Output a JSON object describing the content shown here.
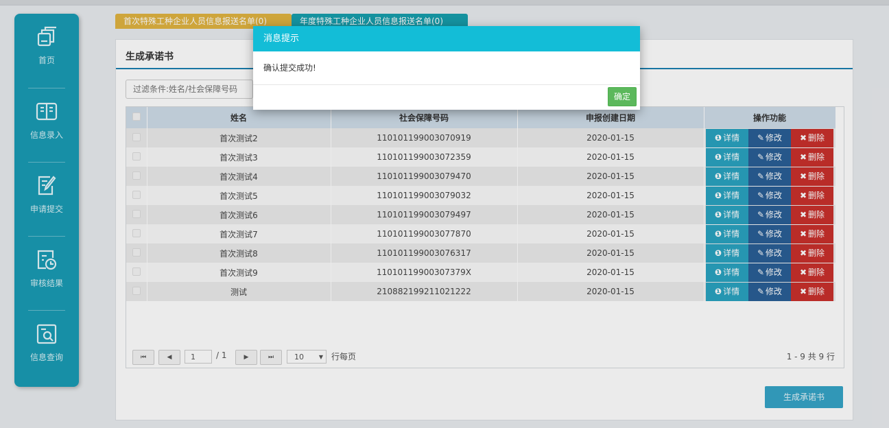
{
  "sidebar": {
    "items": [
      {
        "label": "首页",
        "icon": "copy-icon"
      },
      {
        "label": "信息录入",
        "icon": "book-icon"
      },
      {
        "label": "申请提交",
        "icon": "edit-icon"
      },
      {
        "label": "审核结果",
        "icon": "document-clock-icon"
      },
      {
        "label": "信息查询",
        "icon": "document-search-icon"
      }
    ]
  },
  "tabs": [
    {
      "label": "首次特殊工种企业人员信息报送名单(0)",
      "color": "#e0b341"
    },
    {
      "label": "年度特殊工种企业人员信息报送名单(0)",
      "color": "#179fad"
    }
  ],
  "panel": {
    "title": "生成承诺书",
    "filter_placeholder": "过滤条件:姓名/社会保障号码"
  },
  "table": {
    "columns": [
      "姓名",
      "社会保障号码",
      "申报创建日期",
      "操作功能"
    ],
    "rows": [
      {
        "name": "首次测试2",
        "ssn": "110101199003070919",
        "date": "2020-01-15"
      },
      {
        "name": "首次测试3",
        "ssn": "110101199003072359",
        "date": "2020-01-15"
      },
      {
        "name": "首次测试4",
        "ssn": "110101199003079470",
        "date": "2020-01-15"
      },
      {
        "name": "首次测试5",
        "ssn": "110101199003079032",
        "date": "2020-01-15"
      },
      {
        "name": "首次测试6",
        "ssn": "110101199003079497",
        "date": "2020-01-15"
      },
      {
        "name": "首次测试7",
        "ssn": "110101199003077870",
        "date": "2020-01-15"
      },
      {
        "name": "首次测试8",
        "ssn": "110101199003076317",
        "date": "2020-01-15"
      },
      {
        "name": "首次测试9",
        "ssn": "11010119900307379X",
        "date": "2020-01-15"
      },
      {
        "name": "测试",
        "ssn": "210882199211021222",
        "date": "2020-01-15"
      }
    ],
    "actions": {
      "detail": "详情",
      "edit": "修改",
      "delete": "删除"
    },
    "action_colors": {
      "detail": "#2aa3c0",
      "edit": "#2a5f96",
      "delete": "#c9302c"
    }
  },
  "pager": {
    "first": "⏮",
    "prev": "◀",
    "current_page": "1",
    "total_pages": "/ 1",
    "next": "▶",
    "last": "⏭",
    "page_size": "10",
    "page_size_label": "行每页",
    "info": "1 - 9 共 9 行"
  },
  "generate_button": "生成承诺书",
  "modal": {
    "title": "消息提示",
    "message": "确认提交成功!",
    "ok": "确定"
  }
}
